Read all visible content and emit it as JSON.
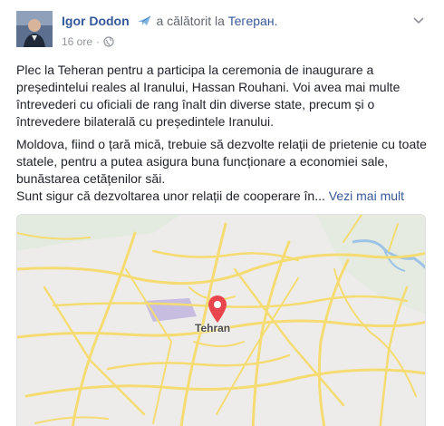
{
  "post": {
    "author": "Igor Dodon",
    "action": "a călătorit la",
    "place": "Teгeран.",
    "time": "16 ore",
    "separator": "·",
    "paragraphs": [
      "Plec la Teheran pentru a participa la ceremonia de inaugurare a președintelui reales al Iranului, Hassan Rouhani. Voi avea mai multe întrevederi cu oficiali de rang înalt din diverse state, precum și o întrevedere bilaterală cu președintele Iranului.",
      "Moldova, fiind o țară mică, trebuie să dezvolte relații de prietenie cu toate statele, pentru a putea asigura buna funcționare a economiei sale, bunăstarea cetățenilor săi."
    ],
    "truncated_line": "Sunt sigur că dezvoltarea unor relații de cooperare în...",
    "see_more": "Vezi mai mult"
  },
  "map": {
    "city_label": "Tehran",
    "road_color": "#f5dc72",
    "water_color": "#9dc3e6",
    "park_color": "#c7bde0",
    "pin_color": "#e8464c"
  },
  "icons": {
    "airplane": "airplane-icon",
    "globe": "globe-icon",
    "chevron": "chevron-down-icon",
    "pin": "map-pin-icon"
  }
}
